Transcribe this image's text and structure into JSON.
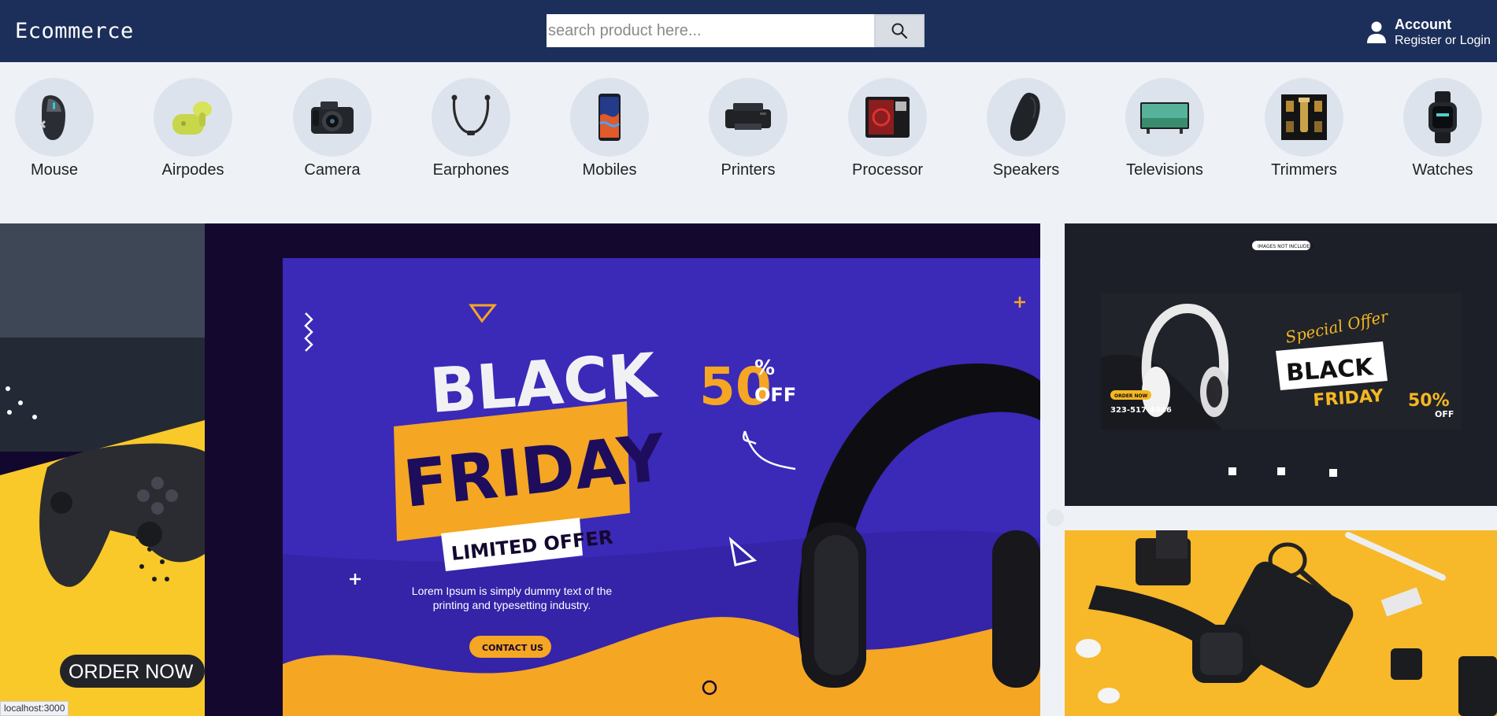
{
  "header": {
    "brand": "Ecommerce",
    "search_placeholder": "search product here...",
    "account_title": "Account",
    "account_sub": "Register or Login"
  },
  "categories": [
    {
      "label": "Mouse",
      "icon": "mouse-icon"
    },
    {
      "label": "Airpodes",
      "icon": "airpods-icon"
    },
    {
      "label": "Camera",
      "icon": "camera-icon"
    },
    {
      "label": "Earphones",
      "icon": "earphones-icon"
    },
    {
      "label": "Mobiles",
      "icon": "mobile-icon"
    },
    {
      "label": "Printers",
      "icon": "printer-icon"
    },
    {
      "label": "Processor",
      "icon": "processor-icon"
    },
    {
      "label": "Speakers",
      "icon": "speaker-icon"
    },
    {
      "label": "Televisions",
      "icon": "television-icon"
    },
    {
      "label": "Trimmers",
      "icon": "trimmer-icon"
    },
    {
      "label": "Watches",
      "icon": "watch-icon"
    }
  ],
  "main_banner": {
    "side_cta": "ORDER NOW",
    "headline_1": "BLACK",
    "headline_2": "FRIDAY",
    "ribbon": "LIMITED OFFER",
    "discount": "50",
    "discount_pct": "%",
    "discount_off": "OFF",
    "body": "Lorem Ipsum is simply dummy text of the printing and typesetting industry.",
    "cta": "CONTACT US"
  },
  "side_banner_top": {
    "tag": "IMAGES NOT INCLUDED",
    "special": "Special Offer",
    "black": "BLACK",
    "friday": "FRIDAY",
    "order_now": "ORDER NOW",
    "phone": "323-517-4946",
    "discount": "50%",
    "off": "OFF"
  },
  "status_url": "localhost:3000",
  "colors": {
    "header_bg": "#1c2f5a",
    "page_bg": "#eef2f7",
    "banner_purple": "#3a1fa8",
    "banner_orange": "#f5a623"
  }
}
